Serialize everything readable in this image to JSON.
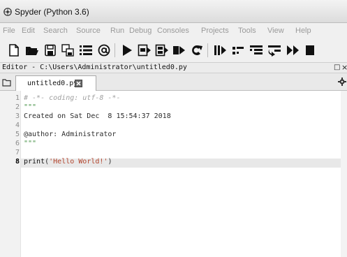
{
  "window": {
    "title": "Spyder (Python 3.6)"
  },
  "menu": [
    "File",
    "Edit",
    "Search",
    "Source",
    "Run",
    "Debug",
    "Consoles",
    "Projects",
    "Tools",
    "View",
    "Help"
  ],
  "toolbar_icons": [
    "new-file-icon",
    "open-folder-icon",
    "save-icon",
    "save-all-icon",
    "list-icon",
    "at-icon",
    "run-icon",
    "run-cell-icon",
    "run-cell-advance-icon",
    "run-selection-icon",
    "rerun-icon",
    "debug-icon",
    "step-icon",
    "step-into-icon",
    "step-return-icon",
    "continue-icon",
    "stop-icon"
  ],
  "pane": {
    "title": "Editor - C:\\Users\\Administrator\\untitled0.py",
    "undock": "ѐ",
    "close": "×"
  },
  "tab": {
    "label": "untitled0.py*"
  },
  "editor": {
    "line_numbers": [
      "1",
      "2",
      "3",
      "4",
      "5",
      "6",
      "7",
      "8"
    ],
    "current_line": "8",
    "lines": [
      [
        {
          "t": "# -*- coding: utf-8 -*-",
          "k": "comment"
        }
      ],
      [
        {
          "t": "\"\"\"",
          "k": "string"
        }
      ],
      [
        {
          "t": "Created on Sat Dec  8 15:54:37 2018",
          "k": "plain"
        }
      ],
      [],
      [
        {
          "t": "@author: Administrator",
          "k": "plain"
        }
      ],
      [
        {
          "t": "\"\"\"",
          "k": "string"
        }
      ],
      [],
      [
        {
          "t": "print",
          "k": "builtin"
        },
        {
          "t": "(",
          "k": "plain"
        },
        {
          "t": "'Hello World!'",
          "k": "str2"
        },
        {
          "t": ")",
          "k": "plain"
        }
      ]
    ]
  },
  "colors": {
    "comment": "#a0a0a0",
    "string": "#3e8d3e",
    "str2": "#b2442c",
    "accent_play": "#111111"
  }
}
